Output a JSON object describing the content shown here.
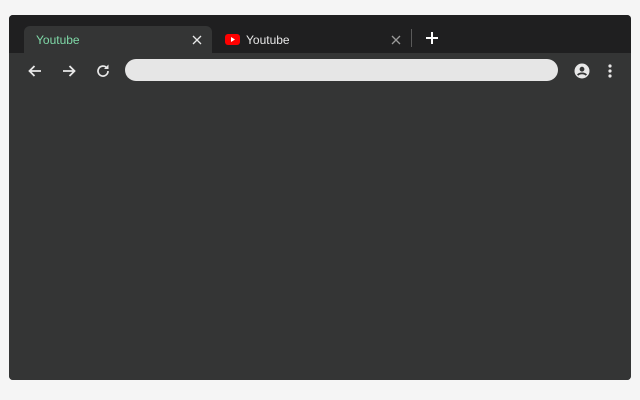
{
  "browser": {
    "tabs": [
      {
        "label": "Youtube",
        "active": true
      },
      {
        "label": "Youtube",
        "active": false,
        "icon": "youtube-icon"
      }
    ],
    "address_bar": {
      "value": "",
      "placeholder": ""
    },
    "toolbar_icons": [
      "back-arrow-icon",
      "forward-arrow-icon",
      "reload-icon",
      "account-icon",
      "more-vert-icon"
    ],
    "colors": {
      "frame": "#1f1f20",
      "toolbar": "#343535",
      "active_tab_text": "#7fd8a7",
      "inactive_tab_text": "#e6e6e6",
      "omnibox": "#e6e6e6",
      "youtube_red": "#ff0000"
    }
  }
}
